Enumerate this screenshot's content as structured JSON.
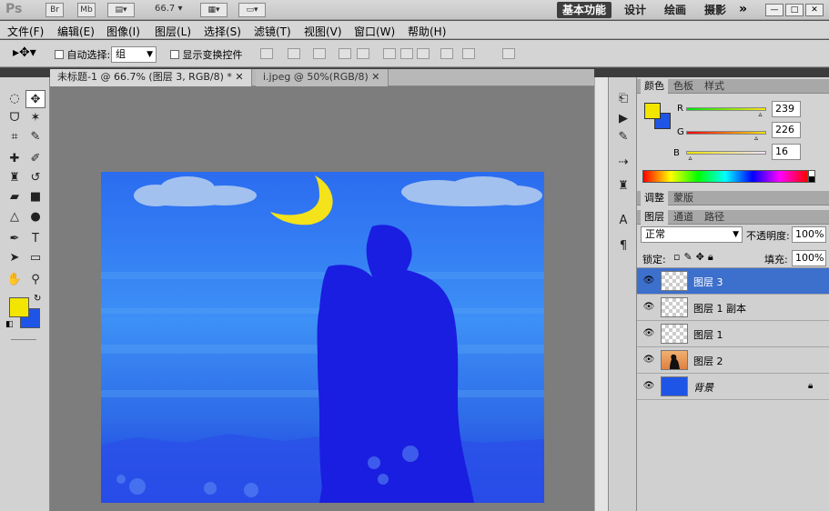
{
  "app": {
    "logo": "Ps",
    "br": "Br",
    "mb": "Mb",
    "zoom": "66.7"
  },
  "workspaces": [
    "基本功能",
    "设计",
    "绘画",
    "摄影"
  ],
  "window_buttons": [
    "—",
    "□",
    "✕"
  ],
  "menu": [
    "文件(F)",
    "编辑(E)",
    "图像(I)",
    "图层(L)",
    "选择(S)",
    "滤镜(T)",
    "视图(V)",
    "窗口(W)",
    "帮助(H)"
  ],
  "options": {
    "auto_select_label": "自动选择:",
    "auto_select_value": "组",
    "show_transform_label": "显示变换控件"
  },
  "doc_tabs": [
    {
      "label": "未标题-1 @ 66.7% (图层 3, RGB/8) *",
      "close": "✕"
    },
    {
      "label": "i.jpeg @ 50%(RGB/8)",
      "close": "✕"
    }
  ],
  "colors": {
    "foreground": "#f2e600",
    "background": "#1f55e6",
    "accent": "#3d6fcc"
  },
  "color_panel": {
    "tabs": [
      "颜色",
      "色板",
      "样式"
    ],
    "channels": [
      {
        "label": "R",
        "value": "239",
        "level": 0.937
      },
      {
        "label": "G",
        "value": "226",
        "level": 0.886
      },
      {
        "label": "B",
        "value": "16",
        "level": 0.063
      }
    ]
  },
  "adjust_tabs": [
    "调整",
    "蒙版"
  ],
  "layers_panel": {
    "tabs": [
      "图层",
      "通道",
      "路径"
    ],
    "blend_mode": "正常",
    "opacity_label": "不透明度:",
    "opacity_value": "100%",
    "lock_label": "锁定:",
    "fill_label": "填充:",
    "fill_value": "100%",
    "layers": [
      {
        "name": "图层 3",
        "selected": true,
        "thumb": "checker"
      },
      {
        "name": "图层 1 副本",
        "selected": false,
        "thumb": "checker"
      },
      {
        "name": "图层 1",
        "selected": false,
        "thumb": "checker"
      },
      {
        "name": "图层 2",
        "selected": false,
        "thumb": "photo"
      },
      {
        "name": "背景",
        "selected": false,
        "thumb": "blue",
        "locked": true
      }
    ]
  }
}
